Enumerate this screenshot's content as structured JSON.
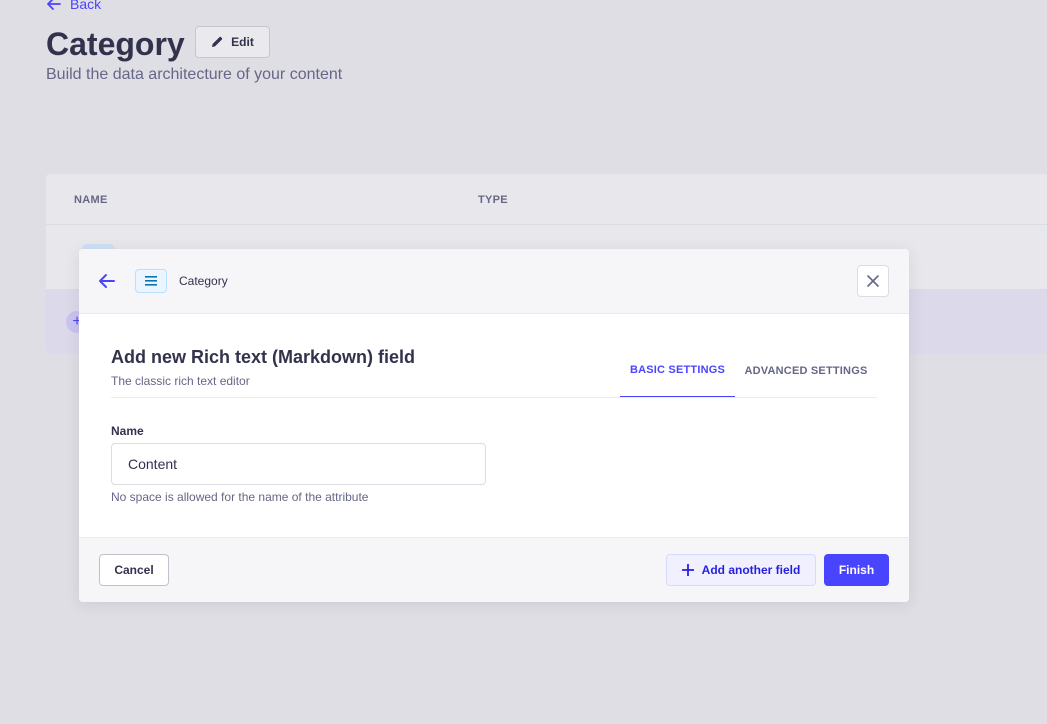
{
  "header": {
    "back_label": "Back",
    "title": "Category",
    "edit_label": "Edit",
    "subtitle": "Build the data architecture of your content"
  },
  "table": {
    "columns": [
      "NAME",
      "TYPE"
    ],
    "add_icon": "+"
  },
  "modal": {
    "breadcrumb": "Category",
    "title": "Add new Rich text (Markdown) field",
    "description": "The classic rich text editor",
    "tabs": [
      {
        "label": "BASIC SETTINGS",
        "active": true
      },
      {
        "label": "ADVANCED SETTINGS",
        "active": false
      }
    ],
    "name_field": {
      "label": "Name",
      "value": "Content",
      "hint": "No space is allowed for the name of the attribute"
    },
    "footer": {
      "cancel_label": "Cancel",
      "add_another_label": "Add another field",
      "finish_label": "Finish"
    }
  },
  "colors": {
    "primary": "#4945ff",
    "background": "#dfdee5",
    "text": "#32324d",
    "muted": "#666687"
  },
  "icons": {
    "back": "arrow-left-icon",
    "edit": "pencil-icon",
    "content_type": "rich-text-icon",
    "close": "close-icon",
    "add": "plus-icon"
  }
}
